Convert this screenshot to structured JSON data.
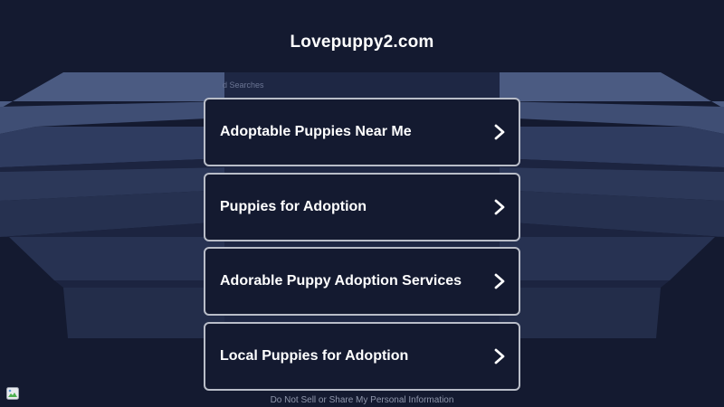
{
  "site": {
    "title": "Lovepuppy2.com"
  },
  "searches_label": "d Searches",
  "results": [
    {
      "label": "Adoptable Puppies Near Me",
      "icon": "chevron-right-icon"
    },
    {
      "label": "Puppies for Adoption",
      "icon": "chevron-right-icon"
    },
    {
      "label": "Adorable Puppy Adoption Services",
      "icon": "chevron-right-icon"
    },
    {
      "label": "Local Puppies for Adoption",
      "icon": "chevron-right-icon"
    }
  ],
  "footer": {
    "privacy_link": "Do Not Sell or Share My Personal Information"
  },
  "colors": {
    "background": "#141a30",
    "card_border": "#b9bdc8",
    "text": "#ffffff",
    "decor_light": "#4a5a80",
    "decor_mid": "#2e3b5c",
    "decor_dark": "#222c48"
  }
}
